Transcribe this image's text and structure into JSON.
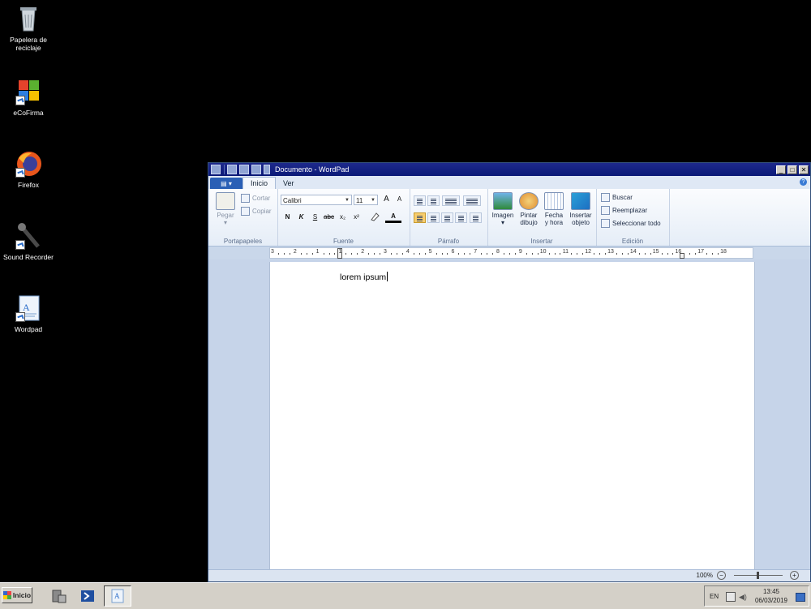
{
  "desktop": {
    "icons": [
      {
        "label": "Papelera de reciclaje"
      },
      {
        "label": "eCoFirma"
      },
      {
        "label": "Firefox"
      },
      {
        "label": "Sound Recorder"
      },
      {
        "label": "Wordpad"
      }
    ]
  },
  "window": {
    "title": "Documento - WordPad",
    "controls": {
      "minimize": "_",
      "maximize": "□",
      "close": "✕"
    }
  },
  "tabs": {
    "home": "Inicio",
    "view": "Ver",
    "help": "?"
  },
  "ribbon": {
    "clipboard": {
      "label": "Portapapeles",
      "paste": "Pegar",
      "cut": "Cortar",
      "copy": "Copiar"
    },
    "font": {
      "label": "Fuente",
      "family": "Calibri",
      "size": "11",
      "grow": "A",
      "shrink": "A",
      "bold": "N",
      "italic": "K",
      "underline": "S",
      "strike": "abc",
      "subscript": "x₂",
      "superscript": "x²",
      "color": "A"
    },
    "paragraph": {
      "label": "Párrafo"
    },
    "insert": {
      "label": "Insertar",
      "image": "Imagen",
      "paint_1": "Pintar",
      "paint_2": "dibujo",
      "datetime_1": "Fecha",
      "datetime_2": "y hora",
      "object_1": "Insertar",
      "object_2": "objeto"
    },
    "editing": {
      "label": "Edición",
      "find": "Buscar",
      "replace": "Reemplazar",
      "select_all": "Seleccionar todo"
    }
  },
  "ruler": {
    "numbers": [
      "3",
      "2",
      "1",
      "1",
      "2",
      "3",
      "4",
      "5",
      "6",
      "7",
      "8",
      "9",
      "10",
      "11",
      "12",
      "13",
      "14",
      "15",
      "16",
      "17",
      "18"
    ]
  },
  "document": {
    "text": "lorem ipsum"
  },
  "status": {
    "zoom": "100%",
    "zoom_out": "−",
    "zoom_in": "+"
  },
  "taskbar": {
    "start": "Inicio",
    "language": "EN",
    "time": "13:45",
    "date": "06/03/2019"
  }
}
